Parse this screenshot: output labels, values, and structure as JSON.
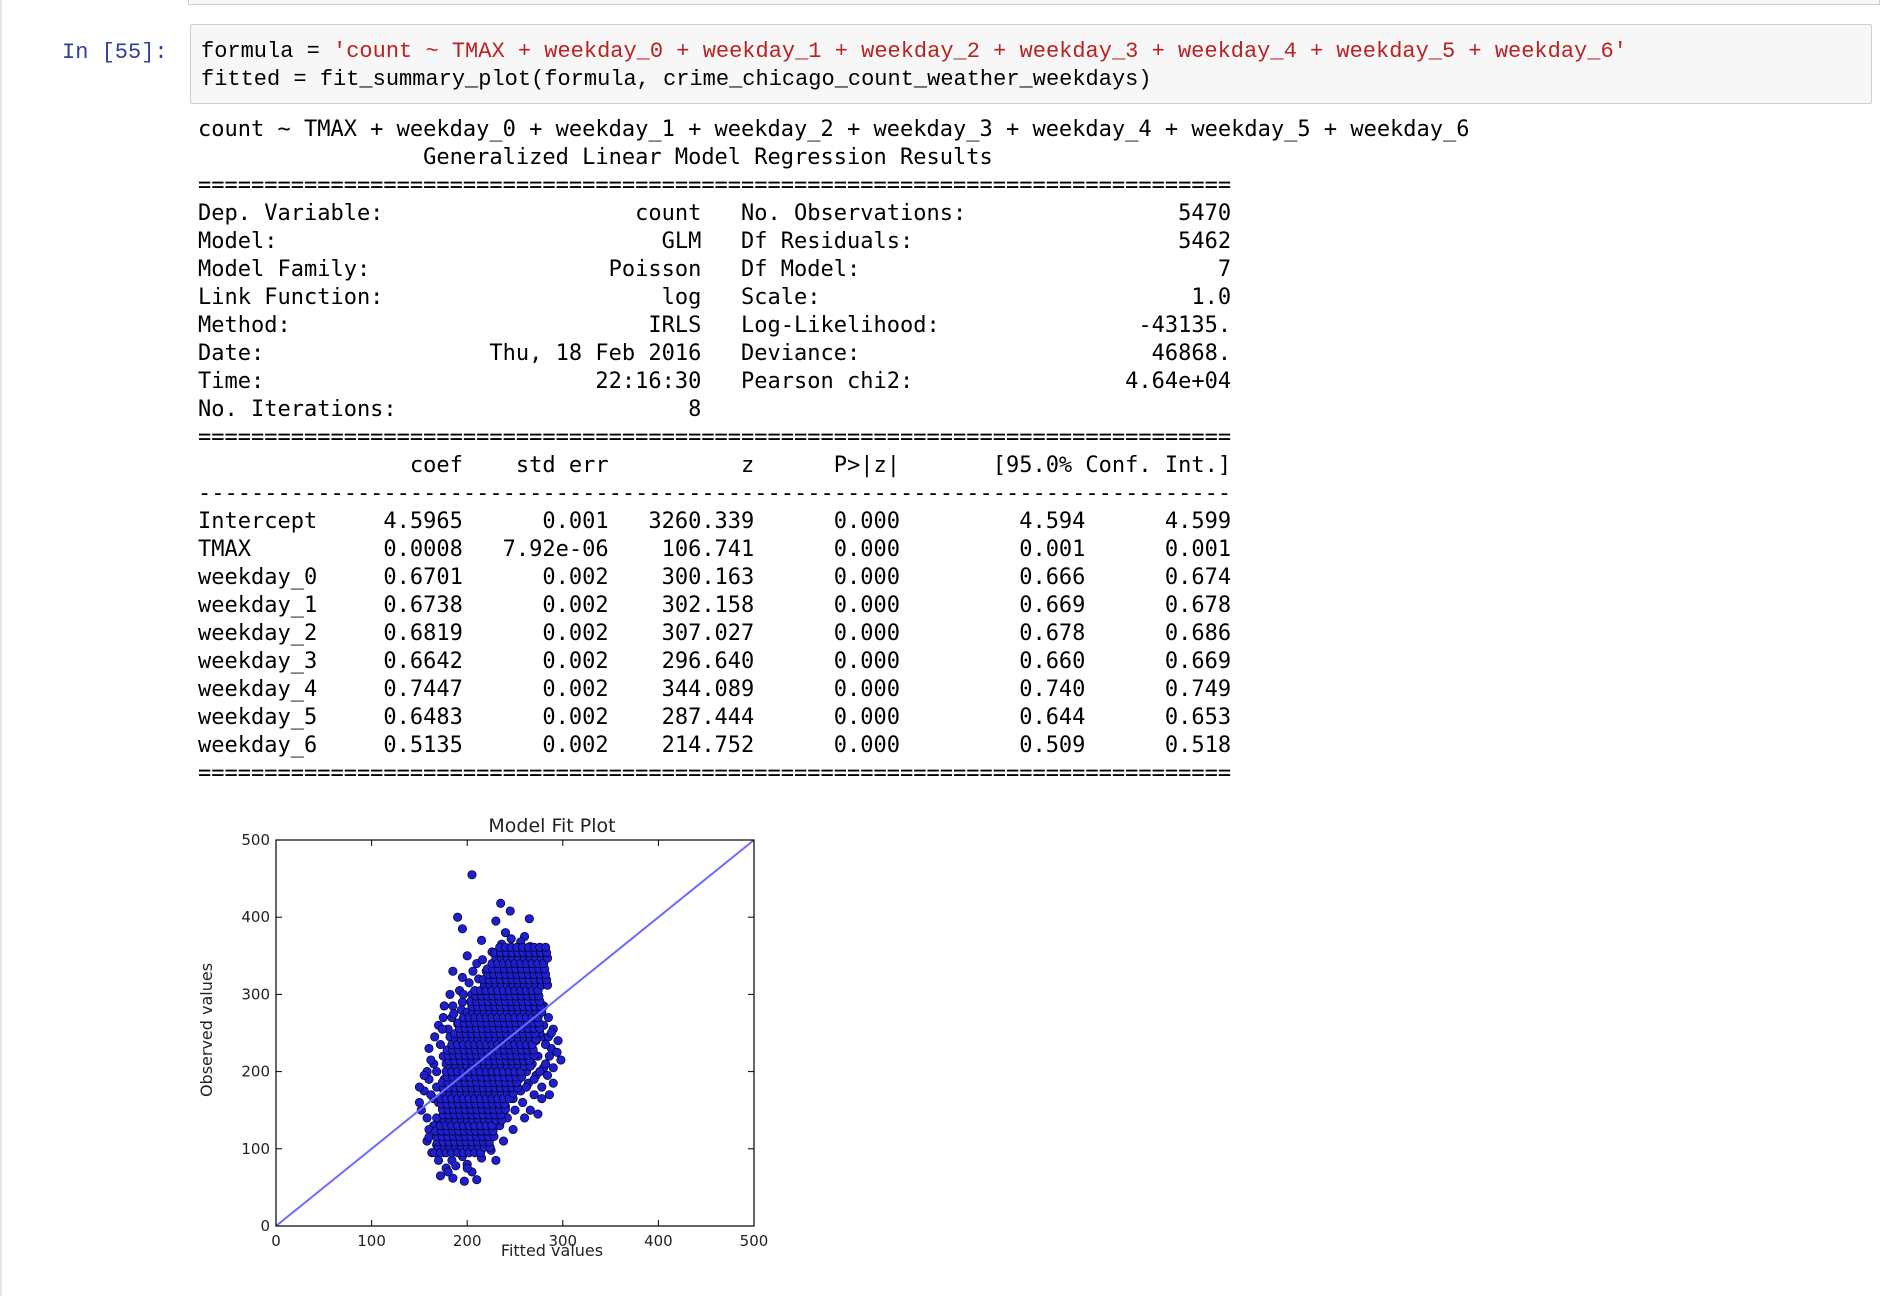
{
  "cell": {
    "prompt": "In [55]:",
    "code": {
      "line1_prefix": "formula = ",
      "line1_string": "'count ~ TMAX + weekday_0 + weekday_1 + weekday_2 + weekday_3 + weekday_4 + weekday_5 + weekday_6'",
      "line2": "fitted = fit_summary_plot(formula, crime_chicago_count_weather_weekdays)"
    }
  },
  "summary": {
    "formula_line": "count ~ TMAX + weekday_0 + weekday_1 + weekday_2 + weekday_3 + weekday_4 + weekday_5 + weekday_6",
    "title": "Generalized Linear Model Regression Results",
    "left_info": [
      [
        "Dep. Variable:",
        "count"
      ],
      [
        "Model:",
        "GLM"
      ],
      [
        "Model Family:",
        "Poisson"
      ],
      [
        "Link Function:",
        "log"
      ],
      [
        "Method:",
        "IRLS"
      ],
      [
        "Date:",
        "Thu, 18 Feb 2016"
      ],
      [
        "Time:",
        "22:16:30"
      ],
      [
        "No. Iterations:",
        "8"
      ]
    ],
    "right_info": [
      [
        "No. Observations:",
        "5470"
      ],
      [
        "Df Residuals:",
        "5462"
      ],
      [
        "Df Model:",
        "7"
      ],
      [
        "Scale:",
        "1.0"
      ],
      [
        "Log-Likelihood:",
        "-43135."
      ],
      [
        "Deviance:",
        "46868."
      ],
      [
        "Pearson chi2:",
        "4.64e+04"
      ],
      [
        "",
        ""
      ]
    ],
    "columns": [
      "coef",
      "std err",
      "z",
      "P>|z|",
      "[95.0% Conf. Int.]"
    ],
    "rows": [
      [
        "Intercept",
        "4.5965",
        "0.001",
        "3260.339",
        "0.000",
        "4.594",
        "4.599"
      ],
      [
        "TMAX",
        "0.0008",
        "7.92e-06",
        "106.741",
        "0.000",
        "0.001",
        "0.001"
      ],
      [
        "weekday_0",
        "0.6701",
        "0.002",
        "300.163",
        "0.000",
        "0.666",
        "0.674"
      ],
      [
        "weekday_1",
        "0.6738",
        "0.002",
        "302.158",
        "0.000",
        "0.669",
        "0.678"
      ],
      [
        "weekday_2",
        "0.6819",
        "0.002",
        "307.027",
        "0.000",
        "0.678",
        "0.686"
      ],
      [
        "weekday_3",
        "0.6642",
        "0.002",
        "296.640",
        "0.000",
        "0.660",
        "0.669"
      ],
      [
        "weekday_4",
        "0.7447",
        "0.002",
        "344.089",
        "0.000",
        "0.740",
        "0.749"
      ],
      [
        "weekday_5",
        "0.6483",
        "0.002",
        "287.444",
        "0.000",
        "0.644",
        "0.653"
      ],
      [
        "weekday_6",
        "0.5135",
        "0.002",
        "214.752",
        "0.000",
        "0.509",
        "0.518"
      ]
    ]
  },
  "chart_data": {
    "type": "scatter",
    "title": "Model Fit Plot",
    "xlabel": "Fitted values",
    "ylabel": "Observed values",
    "xlim": [
      0,
      500
    ],
    "ylim": [
      0,
      500
    ],
    "xticks": [
      "0",
      "100",
      "200",
      "300",
      "400",
      "500"
    ],
    "yticks": [
      "0",
      "100",
      "200",
      "300",
      "400",
      "500"
    ],
    "reference_line": {
      "from": [
        0,
        0
      ],
      "to": [
        500,
        500
      ],
      "color": "#6b6bff"
    },
    "point_color": "#1f1fd0",
    "point_edge_color": "#000022",
    "points": [
      [
        205,
        455
      ],
      [
        235,
        418
      ],
      [
        245,
        408
      ],
      [
        190,
        400
      ],
      [
        195,
        385
      ],
      [
        230,
        395
      ],
      [
        260,
        375
      ],
      [
        265,
        398
      ],
      [
        255,
        360
      ],
      [
        240,
        380
      ],
      [
        215,
        370
      ],
      [
        200,
        350
      ],
      [
        210,
        340
      ],
      [
        185,
        330
      ],
      [
        195,
        322
      ],
      [
        220,
        330
      ],
      [
        230,
        350
      ],
      [
        240,
        360
      ],
      [
        250,
        350
      ],
      [
        270,
        340
      ],
      [
        275,
        330
      ],
      [
        260,
        320
      ],
      [
        245,
        330
      ],
      [
        235,
        320
      ],
      [
        225,
        312
      ],
      [
        215,
        305
      ],
      [
        205,
        300
      ],
      [
        195,
        290
      ],
      [
        185,
        285
      ],
      [
        175,
        270
      ],
      [
        170,
        260
      ],
      [
        180,
        255
      ],
      [
        190,
        262
      ],
      [
        200,
        270
      ],
      [
        210,
        280
      ],
      [
        220,
        290
      ],
      [
        230,
        300
      ],
      [
        240,
        310
      ],
      [
        250,
        300
      ],
      [
        260,
        290
      ],
      [
        270,
        300
      ],
      [
        280,
        285
      ],
      [
        285,
        270
      ],
      [
        290,
        255
      ],
      [
        295,
        240
      ],
      [
        298,
        215
      ],
      [
        288,
        230
      ],
      [
        278,
        245
      ],
      [
        268,
        260
      ],
      [
        258,
        270
      ],
      [
        248,
        280
      ],
      [
        238,
        270
      ],
      [
        228,
        260
      ],
      [
        218,
        250
      ],
      [
        208,
        240
      ],
      [
        198,
        230
      ],
      [
        188,
        220
      ],
      [
        178,
        210
      ],
      [
        168,
        200
      ],
      [
        160,
        190
      ],
      [
        155,
        175
      ],
      [
        150,
        160
      ],
      [
        152,
        150
      ],
      [
        158,
        140
      ],
      [
        165,
        130
      ],
      [
        172,
        120
      ],
      [
        180,
        110
      ],
      [
        188,
        100
      ],
      [
        195,
        90
      ],
      [
        200,
        80
      ],
      [
        205,
        70
      ],
      [
        210,
        60
      ],
      [
        197,
        58
      ],
      [
        185,
        62
      ],
      [
        178,
        75
      ],
      [
        170,
        85
      ],
      [
        163,
        95
      ],
      [
        158,
        110
      ],
      [
        160,
        125
      ],
      [
        168,
        140
      ],
      [
        175,
        150
      ],
      [
        182,
        160
      ],
      [
        190,
        170
      ],
      [
        198,
        180
      ],
      [
        206,
        190
      ],
      [
        214,
        200
      ],
      [
        222,
        210
      ],
      [
        230,
        220
      ],
      [
        238,
        230
      ],
      [
        246,
        240
      ],
      [
        254,
        250
      ],
      [
        262,
        260
      ],
      [
        270,
        270
      ],
      [
        276,
        250
      ],
      [
        282,
        235
      ],
      [
        286,
        220
      ],
      [
        280,
        205
      ],
      [
        272,
        195
      ],
      [
        264,
        185
      ],
      [
        256,
        175
      ],
      [
        248,
        165
      ],
      [
        240,
        155
      ],
      [
        232,
        145
      ],
      [
        224,
        135
      ],
      [
        216,
        125
      ],
      [
        208,
        115
      ],
      [
        200,
        105
      ],
      [
        192,
        95
      ],
      [
        184,
        85
      ],
      [
        176,
        95
      ],
      [
        168,
        105
      ],
      [
        160,
        115
      ],
      [
        165,
        165
      ],
      [
        172,
        180
      ],
      [
        180,
        195
      ],
      [
        188,
        210
      ],
      [
        196,
        225
      ],
      [
        204,
        240
      ],
      [
        212,
        255
      ],
      [
        220,
        270
      ],
      [
        228,
        285
      ],
      [
        236,
        295
      ],
      [
        244,
        305
      ],
      [
        252,
        315
      ],
      [
        260,
        325
      ],
      [
        268,
        315
      ],
      [
        274,
        300
      ],
      [
        266,
        290
      ],
      [
        256,
        280
      ],
      [
        246,
        265
      ],
      [
        236,
        250
      ],
      [
        226,
        240
      ],
      [
        216,
        230
      ],
      [
        206,
        220
      ],
      [
        196,
        210
      ],
      [
        186,
        200
      ],
      [
        176,
        190
      ],
      [
        168,
        180
      ],
      [
        162,
        170
      ],
      [
        170,
        160
      ],
      [
        178,
        170
      ],
      [
        186,
        180
      ],
      [
        194,
        190
      ],
      [
        202,
        200
      ],
      [
        210,
        210
      ],
      [
        218,
        220
      ],
      [
        226,
        230
      ],
      [
        234,
        240
      ],
      [
        242,
        250
      ],
      [
        250,
        260
      ],
      [
        258,
        240
      ],
      [
        266,
        230
      ],
      [
        274,
        220
      ],
      [
        282,
        210
      ],
      [
        276,
        200
      ],
      [
        268,
        210
      ],
      [
        260,
        220
      ],
      [
        252,
        230
      ],
      [
        244,
        220
      ],
      [
        236,
        210
      ],
      [
        228,
        200
      ],
      [
        220,
        190
      ],
      [
        212,
        180
      ],
      [
        204,
        170
      ],
      [
        196,
        160
      ],
      [
        188,
        150
      ],
      [
        180,
        140
      ],
      [
        172,
        130
      ],
      [
        190,
        130
      ],
      [
        198,
        140
      ],
      [
        206,
        150
      ],
      [
        214,
        160
      ],
      [
        222,
        170
      ],
      [
        230,
        180
      ],
      [
        238,
        190
      ],
      [
        246,
        200
      ],
      [
        254,
        210
      ],
      [
        262,
        200
      ],
      [
        270,
        190
      ],
      [
        278,
        180
      ],
      [
        284,
        195
      ],
      [
        290,
        205
      ],
      [
        294,
        225
      ],
      [
        285,
        245
      ],
      [
        275,
        260
      ],
      [
        265,
        280
      ],
      [
        255,
        295
      ],
      [
        245,
        290
      ],
      [
        235,
        280
      ],
      [
        225,
        270
      ],
      [
        215,
        260
      ],
      [
        205,
        250
      ],
      [
        195,
        240
      ],
      [
        185,
        230
      ],
      [
        175,
        220
      ],
      [
        165,
        210
      ],
      [
        158,
        200
      ],
      [
        162,
        215
      ],
      [
        172,
        235
      ],
      [
        182,
        245
      ],
      [
        192,
        255
      ],
      [
        202,
        265
      ],
      [
        212,
        275
      ],
      [
        222,
        285
      ],
      [
        232,
        265
      ],
      [
        242,
        255
      ],
      [
        252,
        245
      ],
      [
        262,
        235
      ],
      [
        272,
        240
      ],
      [
        280,
        260
      ],
      [
        288,
        250
      ],
      [
        150,
        180
      ],
      [
        155,
        195
      ],
      [
        160,
        230
      ],
      [
        166,
        245
      ],
      [
        174,
        255
      ],
      [
        184,
        270
      ],
      [
        194,
        280
      ],
      [
        204,
        290
      ],
      [
        214,
        295
      ],
      [
        224,
        300
      ],
      [
        234,
        310
      ],
      [
        244,
        320
      ],
      [
        254,
        330
      ],
      [
        264,
        340
      ],
      [
        272,
        350
      ],
      [
        262,
        355
      ],
      [
        252,
        345
      ],
      [
        242,
        340
      ],
      [
        232,
        335
      ],
      [
        222,
        325
      ],
      [
        212,
        320
      ],
      [
        202,
        315
      ],
      [
        192,
        305
      ],
      [
        182,
        300
      ],
      [
        176,
        285
      ],
      [
        186,
        275
      ],
      [
        196,
        300
      ],
      [
        206,
        330
      ],
      [
        216,
        345
      ],
      [
        226,
        355
      ],
      [
        236,
        365
      ],
      [
        246,
        372
      ],
      [
        256,
        368
      ],
      [
        266,
        362
      ],
      [
        276,
        355
      ],
      [
        182,
        120
      ],
      [
        190,
        115
      ],
      [
        198,
        120
      ],
      [
        206,
        130
      ],
      [
        214,
        140
      ],
      [
        222,
        150
      ],
      [
        230,
        160
      ],
      [
        238,
        170
      ],
      [
        246,
        180
      ],
      [
        254,
        190
      ],
      [
        262,
        180
      ],
      [
        270,
        170
      ],
      [
        278,
        165
      ],
      [
        286,
        170
      ],
      [
        290,
        185
      ],
      [
        210,
        100
      ],
      [
        218,
        110
      ],
      [
        226,
        120
      ],
      [
        234,
        130
      ],
      [
        242,
        140
      ],
      [
        250,
        150
      ],
      [
        258,
        160
      ],
      [
        266,
        150
      ],
      [
        274,
        145
      ],
      [
        180,
        70
      ],
      [
        188,
        78
      ],
      [
        215,
        88
      ],
      [
        225,
        98
      ],
      [
        238,
        110
      ],
      [
        248,
        125
      ],
      [
        260,
        140
      ],
      [
        200,
        75
      ],
      [
        230,
        85
      ],
      [
        172,
        65
      ]
    ]
  }
}
